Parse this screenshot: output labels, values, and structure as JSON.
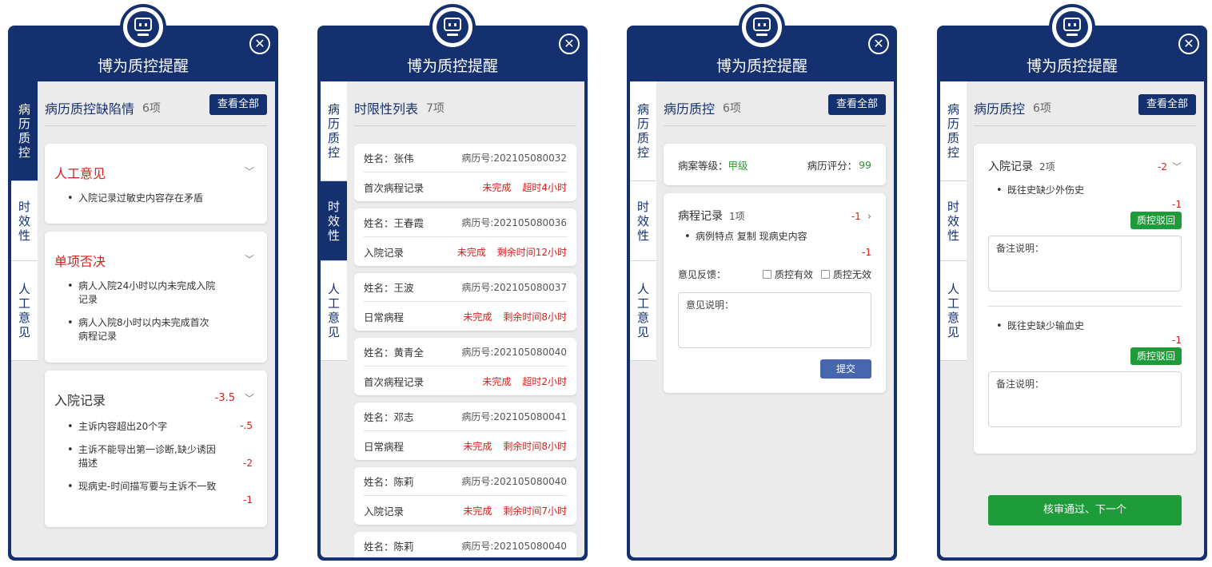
{
  "app_title": "博为质控提醒",
  "close_symbol": "✕",
  "tabs": {
    "t1": [
      "病",
      "历",
      "质",
      "控"
    ],
    "t2": [
      "时",
      "效",
      "性"
    ],
    "t3": [
      "人",
      "工",
      "意",
      "见"
    ]
  },
  "view_all_label": "查看全部",
  "panel1": {
    "title": "病历质控缺陷情",
    "count": "6项",
    "cards": [
      {
        "title": "人工意见",
        "items": [
          {
            "text": "入院记录过敏史内容存在矛盾"
          }
        ]
      },
      {
        "title": "单项否决",
        "items": [
          {
            "text": "病人入院24小时以内未完成入院记录"
          },
          {
            "text": "病人入院8小时以内未完成首次病程记录"
          }
        ]
      },
      {
        "title": "入院记录",
        "score": "-3.5",
        "items": [
          {
            "text": "主诉内容超出20个字",
            "score": "-.5"
          },
          {
            "text": "主诉不能导出第一诊断,缺少诱因描述",
            "score": "-2"
          },
          {
            "text": "现病史-时间描写要与主诉不一致",
            "score": "-1"
          }
        ]
      }
    ]
  },
  "panel2": {
    "title": "时限性列表",
    "count": "7项",
    "rows": [
      {
        "name": "姓名：张伟",
        "no": "病历号:202105080032",
        "record": "首次病程记录",
        "status": "未完成",
        "time": "超时4小时"
      },
      {
        "name": "姓名：王春霞",
        "no": "病历号:202105080036",
        "record": "入院记录",
        "status": "未完成",
        "time": "剩余时间12小时"
      },
      {
        "name": "姓名：王波",
        "no": "病历号:202105080037",
        "record": "日常病程",
        "status": "未完成",
        "time": "剩余时间8小时"
      },
      {
        "name": "姓名：黄青全",
        "no": "病历号:202105080040",
        "record": "首次病程记录",
        "status": "未完成",
        "time": "超时2小时"
      },
      {
        "name": "姓名：邓志",
        "no": "病历号:202105080041",
        "record": "日常病程",
        "status": "未完成",
        "time": "剩余时间8小时"
      },
      {
        "name": "姓名：陈莉",
        "no": "病历号:202105080040",
        "record": "入院记录",
        "status": "未完成",
        "time": "剩余时间7小时"
      },
      {
        "name": "姓名：陈莉",
        "no": "病历号:202105080040",
        "record": "",
        "status": "",
        "time": ""
      }
    ]
  },
  "panel3": {
    "title": "病历质控",
    "count": "6项",
    "grade_label": "病案等级：",
    "grade_value": "甲级",
    "score_label": "病历评分：",
    "score_value": "99",
    "course_title": "病程记录",
    "course_count": "1项",
    "course_score": "-1",
    "course_item": "病例特点 复制 现病史内容",
    "course_item_score": "-1",
    "feedback_label": "意见反馈：",
    "opt_valid": "质控有效",
    "opt_invalid": "质控无效",
    "opinion_placeholder": "意见说明：",
    "submit_label": "提交"
  },
  "panel4": {
    "title": "病历质控",
    "count": "6项",
    "section_title": "入院记录",
    "section_count": "2项",
    "section_score": "-2",
    "items": [
      {
        "text": "既往史缺少外伤史",
        "score": "-1",
        "reject": "质控驳回",
        "note": "备注说明："
      },
      {
        "text": "既往史缺少输血史",
        "score": "-1",
        "reject": "质控驳回",
        "note": "备注说明："
      }
    ],
    "approve_label": "核审通过、下一个"
  },
  "colors": {
    "navy": "#15306f",
    "red": "#d6201c",
    "green": "#1f9c3a",
    "grade_green": "#2e9a2e"
  }
}
